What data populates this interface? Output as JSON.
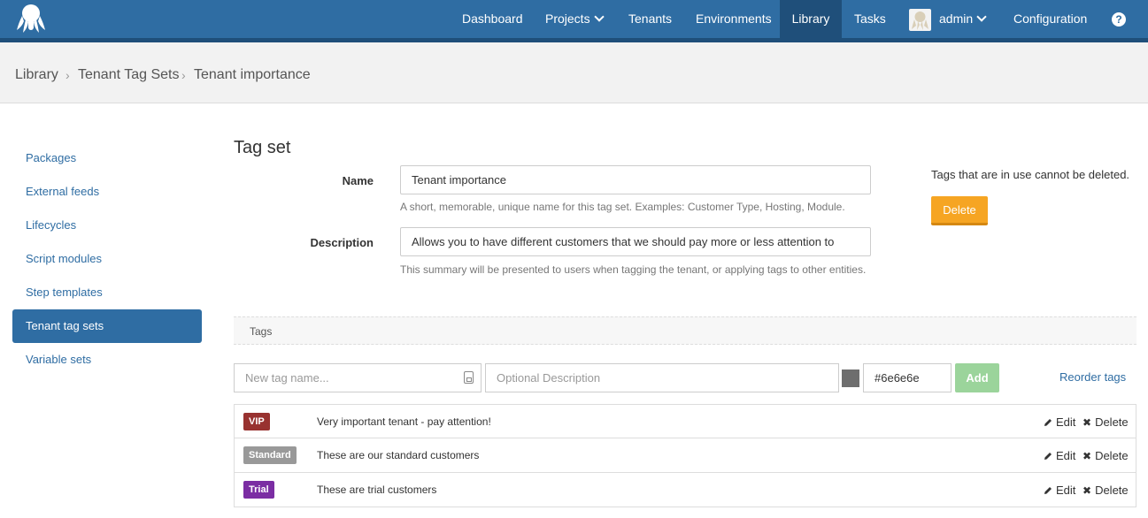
{
  "nav": {
    "items": [
      {
        "label": "Dashboard",
        "dropdown": false
      },
      {
        "label": "Projects",
        "dropdown": true
      },
      {
        "label": "Tenants",
        "dropdown": false
      },
      {
        "label": "Environments",
        "dropdown": false
      },
      {
        "label": "Library",
        "dropdown": false,
        "active": true
      },
      {
        "label": "Tasks",
        "dropdown": false
      }
    ],
    "user": "admin",
    "configuration": "Configuration",
    "help": "?"
  },
  "breadcrumb": [
    "Library",
    "Tenant Tag Sets",
    "Tenant importance"
  ],
  "sidebar": {
    "items": [
      {
        "label": "Packages"
      },
      {
        "label": "External feeds"
      },
      {
        "label": "Lifecycles"
      },
      {
        "label": "Script modules"
      },
      {
        "label": "Step templates"
      },
      {
        "label": "Tenant tag sets",
        "active": true
      },
      {
        "label": "Variable sets"
      }
    ]
  },
  "form": {
    "heading": "Tag set",
    "name_label": "Name",
    "name_value": "Tenant importance",
    "name_help": "A short, memorable, unique name for this tag set. Examples: Customer Type, Hosting, Module.",
    "description_label": "Description",
    "description_value": "Allows you to have different customers that we should pay more or less attention to",
    "description_help": "This summary will be presented to users when tagging the tenant, or applying tags to other entities.",
    "in_use_note": "Tags that are in use cannot be deleted.",
    "delete_label": "Delete"
  },
  "tags": {
    "section_label": "Tags",
    "new_tag_placeholder": "New tag name...",
    "description_placeholder": "Optional Description",
    "color_value": "#6e6e6e",
    "add_label": "Add",
    "reorder_label": "Reorder tags",
    "edit_label": "Edit",
    "delete_label": "Delete",
    "rows": [
      {
        "name": "VIP",
        "color": "#983230",
        "description": "Very important tenant - pay attention!"
      },
      {
        "name": "Standard",
        "color": "#999999",
        "description": "These are our standard customers"
      },
      {
        "name": "Trial",
        "color": "#7b2da3",
        "description": "These are trial customers"
      }
    ]
  },
  "colors": {
    "nav_bg": "#2f6da3",
    "accent": "#2f6da3",
    "delete_button": "#f6a523",
    "add_button": "#9bd49b"
  }
}
